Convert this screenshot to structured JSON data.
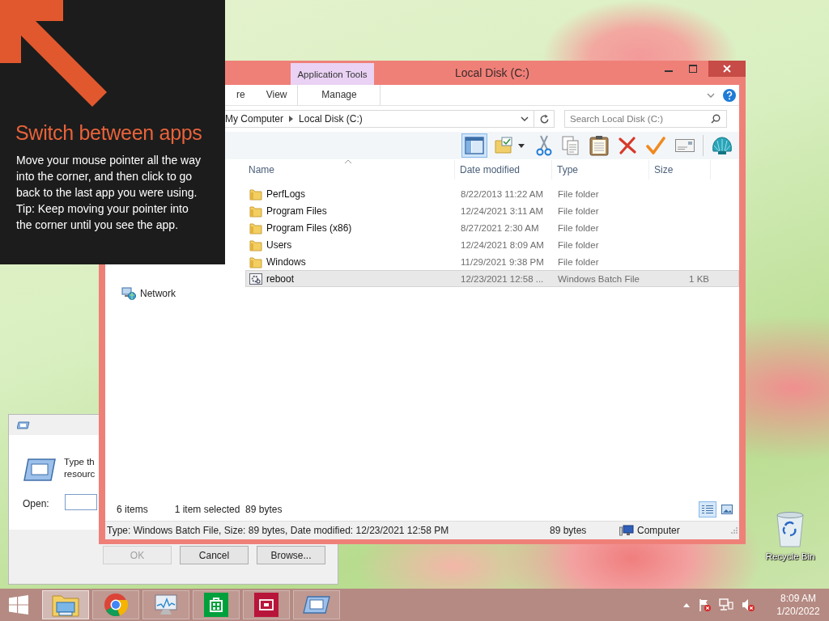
{
  "charm_tip": {
    "title": "Switch between apps",
    "body": "Move your mouse pointer all the way into the corner, and then click to go back to the last app you were using.",
    "tip": "Tip: Keep moving your pointer into the corner until you see the app."
  },
  "run_dialog": {
    "prompt_lines": [
      "Type th",
      "resourc"
    ],
    "open_label": "Open:",
    "buttons": [
      {
        "label": "OK",
        "disabled": true
      },
      {
        "label": "Cancel",
        "disabled": false
      },
      {
        "label": "Browse...",
        "disabled": false
      }
    ]
  },
  "explorer": {
    "title": "Local Disk (C:)",
    "context_tab_group": "Application Tools",
    "ribbon_tabs": [
      {
        "label": "re",
        "selected": false
      },
      {
        "label": "View",
        "selected": false
      },
      {
        "label": "Manage",
        "selected": false
      }
    ],
    "breadcrumb": [
      "My Computer",
      "Local Disk (C:)"
    ],
    "search": {
      "placeholder": "Search Local Disk (C:)"
    },
    "preview_pane_button": {
      "on": true
    },
    "toolbar": [
      {
        "kind": "folder"
      },
      {
        "kind": "scissors"
      },
      {
        "kind": "copy"
      },
      {
        "kind": "clipboard"
      },
      {
        "kind": "cross"
      },
      {
        "kind": "check"
      },
      {
        "kind": "card"
      },
      {
        "kind": "shell"
      }
    ],
    "nav_items": [
      {
        "label": "Network"
      }
    ],
    "columns": [
      "Name",
      "Date modified",
      "Type",
      "Size"
    ],
    "rows": [
      {
        "kind": "folder",
        "name": "PerfLogs",
        "date": "8/22/2013 11:22 AM",
        "type": "File folder",
        "selected": false
      },
      {
        "kind": "folder",
        "name": "Program Files",
        "date": "12/24/2021 3:11 AM",
        "type": "File folder",
        "selected": false
      },
      {
        "kind": "folder",
        "name": "Program Files (x86)",
        "date": "8/27/2021 2:30 AM",
        "type": "File folder",
        "selected": false
      },
      {
        "kind": "folder",
        "name": "Users",
        "date": "12/24/2021 8:09 AM",
        "type": "File folder",
        "selected": false
      },
      {
        "kind": "folder",
        "name": "Windows",
        "date": "11/29/2021 9:38 PM",
        "type": "File folder",
        "selected": false
      },
      {
        "kind": "batch",
        "name": "reboot",
        "date": "12/23/2021 12:58 ...",
        "type": "Windows Batch File",
        "size": "1 KB",
        "selected": true
      }
    ],
    "item_count": "6 items",
    "selection_info": "1 item selected  89 bytes",
    "view_buttons": [
      {
        "kind": "details",
        "selected": true
      },
      {
        "kind": "large-icons",
        "selected": false
      }
    ],
    "status_bar": {
      "details": "Type: Windows Batch File, Size: 89 bytes, Date modified: 12/23/2021 12:58 PM",
      "size": "89 bytes",
      "zone": "Computer"
    }
  },
  "desktop_icons": [
    {
      "label": "Recycle Bin"
    }
  ],
  "taskbar": {
    "apps": [
      {
        "kind": "explorer",
        "selected": true
      },
      {
        "kind": "browser",
        "selected": false
      },
      {
        "kind": "monitor",
        "selected": false
      },
      {
        "kind": "store",
        "selected": false
      },
      {
        "kind": "media",
        "selected": false
      },
      {
        "kind": "run",
        "selected": false
      }
    ],
    "time": "8:09 AM",
    "date": "1/20/2022"
  }
}
